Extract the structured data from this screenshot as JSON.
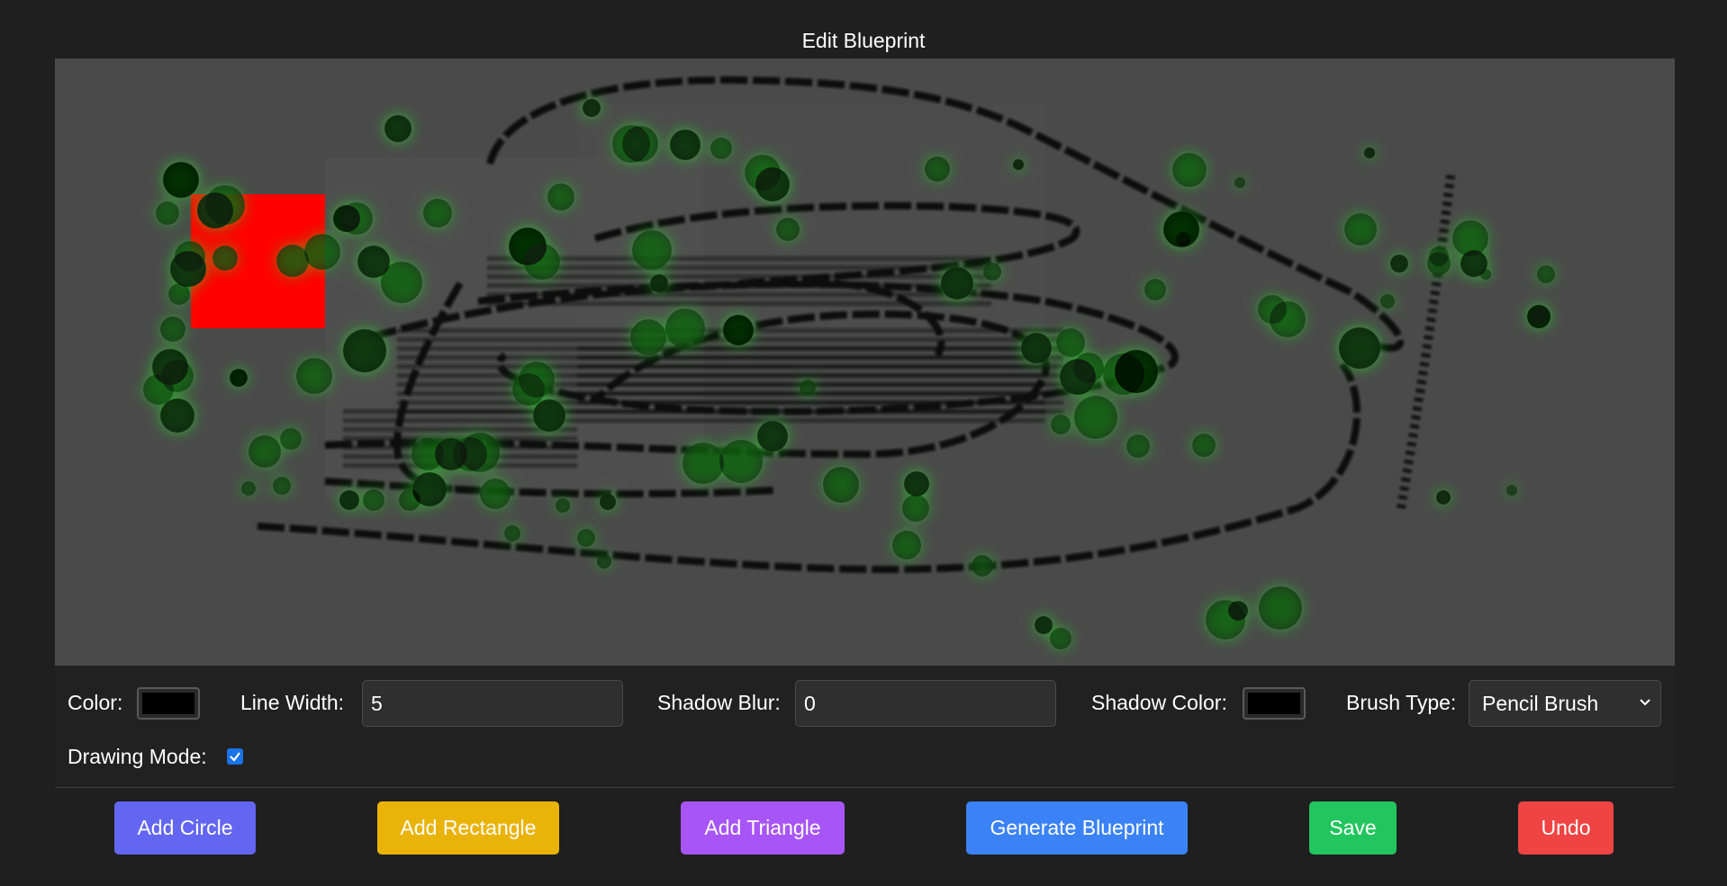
{
  "page": {
    "title": "Edit Blueprint"
  },
  "canvas": {
    "background_color": "#4a4a4a",
    "shapes": [
      {
        "type": "rectangle",
        "fill": "#ff0000"
      },
      {
        "type": "freehand-strokes",
        "stroke": "#000000",
        "style": "dashed-horizontal"
      },
      {
        "type": "circles",
        "fill": "#0a1a0a",
        "shadow_color": "#22ff22"
      }
    ]
  },
  "controls": {
    "color_label": "Color:",
    "color_value": "#000000",
    "line_width_label": "Line Width:",
    "line_width_value": "5",
    "shadow_blur_label": "Shadow Blur:",
    "shadow_blur_value": "0",
    "shadow_color_label": "Shadow Color:",
    "shadow_color_value": "#000000",
    "brush_type_label": "Brush Type:",
    "brush_type_value": "Pencil Brush",
    "drawing_mode_label": "Drawing Mode:",
    "drawing_mode_checked": true
  },
  "buttons": [
    {
      "label": "Add Circle",
      "color": "#6366f1"
    },
    {
      "label": "Add Rectangle",
      "color": "#eab308"
    },
    {
      "label": "Add Triangle",
      "color": "#a855f7"
    },
    {
      "label": "Generate Blueprint",
      "color": "#3b82f6"
    },
    {
      "label": "Save",
      "color": "#22c55e"
    },
    {
      "label": "Undo",
      "color": "#ef4444"
    }
  ],
  "icons": {
    "brush_select": "chevron-down-icon",
    "drawing_mode": "checkmark-icon"
  }
}
